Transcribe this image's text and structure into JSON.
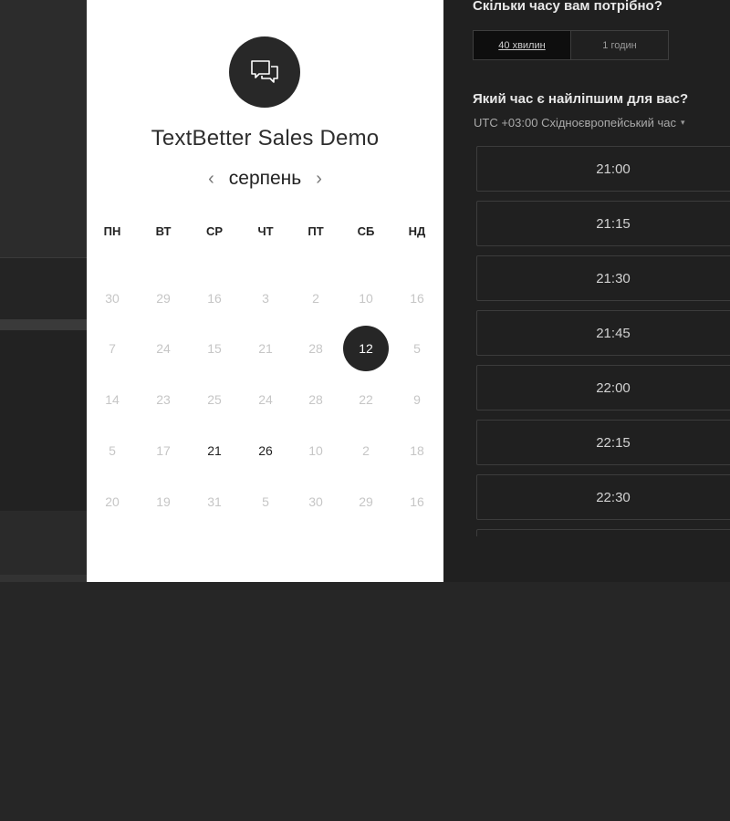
{
  "modal": {
    "title": "TextBetter Sales Demo",
    "avatar_icon": "chat-bubbles-icon",
    "month": "серпень",
    "prev_arrow": "‹",
    "next_arrow": "›",
    "weekdays": [
      "ПН",
      "ВТ",
      "СР",
      "ЧТ",
      "ПТ",
      "СБ",
      "НД"
    ],
    "weeks": [
      [
        {
          "d": "30",
          "s": "muted"
        },
        {
          "d": "29",
          "s": "muted"
        },
        {
          "d": "16",
          "s": "muted"
        },
        {
          "d": "3",
          "s": "muted"
        },
        {
          "d": "2",
          "s": "muted"
        },
        {
          "d": "10",
          "s": "muted"
        },
        {
          "d": "16",
          "s": "muted"
        }
      ],
      [
        {
          "d": "7",
          "s": "muted"
        },
        {
          "d": "24",
          "s": "muted"
        },
        {
          "d": "15",
          "s": "muted"
        },
        {
          "d": "21",
          "s": "muted"
        },
        {
          "d": "28",
          "s": "muted"
        },
        {
          "d": "12",
          "s": "selected"
        },
        {
          "d": "5",
          "s": "muted"
        }
      ],
      [
        {
          "d": "14",
          "s": "muted"
        },
        {
          "d": "23",
          "s": "muted"
        },
        {
          "d": "25",
          "s": "muted"
        },
        {
          "d": "24",
          "s": "muted"
        },
        {
          "d": "28",
          "s": "muted"
        },
        {
          "d": "22",
          "s": "muted"
        },
        {
          "d": "9",
          "s": "muted"
        }
      ],
      [
        {
          "d": "5",
          "s": "muted"
        },
        {
          "d": "17",
          "s": "muted"
        },
        {
          "d": "21",
          "s": "avail"
        },
        {
          "d": "26",
          "s": "avail"
        },
        {
          "d": "10",
          "s": "muted"
        },
        {
          "d": "2",
          "s": "muted"
        },
        {
          "d": "18",
          "s": "muted"
        }
      ],
      [
        {
          "d": "20",
          "s": "muted"
        },
        {
          "d": "19",
          "s": "muted"
        },
        {
          "d": "31",
          "s": "muted"
        },
        {
          "d": "5",
          "s": "muted"
        },
        {
          "d": "30",
          "s": "muted"
        },
        {
          "d": "29",
          "s": "muted"
        },
        {
          "d": "16",
          "s": "muted"
        }
      ]
    ]
  },
  "booking": {
    "duration_question": "Скільки часу вам потрібно?",
    "durations": [
      {
        "label": "40 хвилин",
        "active": true
      },
      {
        "label": "1 годин",
        "active": false
      }
    ],
    "time_question": "Який час є найліпшим для вас?",
    "timezone": "UTC +03:00 Східноєвропейський час",
    "timezone_caret": "▾",
    "slots": [
      "21:00",
      "21:15",
      "21:30",
      "21:45",
      "22:00",
      "22:15",
      "22:30",
      ""
    ]
  },
  "colors": {
    "background": "#262626",
    "modal": "#ffffff",
    "selected_day": "#262626",
    "panel": "#202020"
  }
}
